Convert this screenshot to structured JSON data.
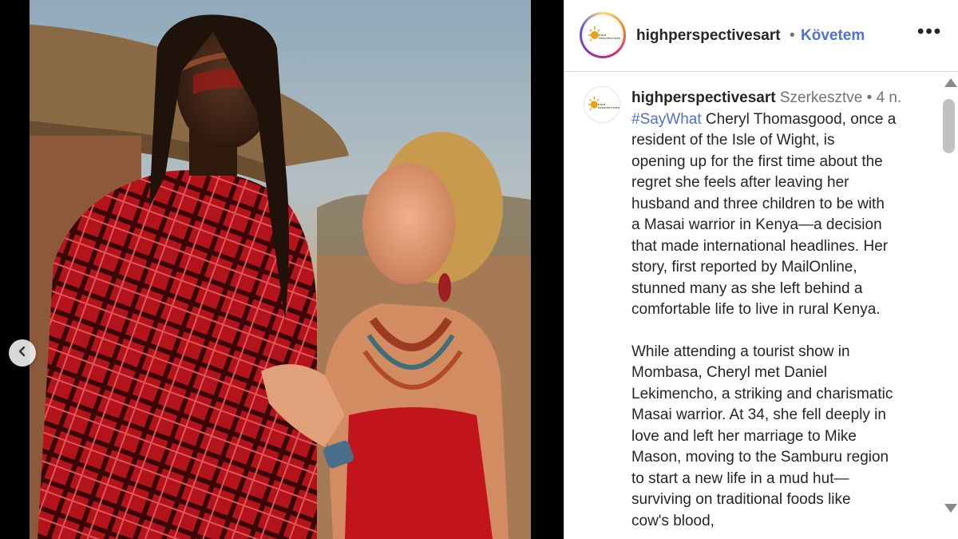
{
  "header": {
    "username": "highperspectivesart",
    "separator": "•",
    "follow_label": "Követem",
    "more_label": "•••"
  },
  "caption": {
    "username": "highperspectivesart",
    "edited_label": "Szerkesztve",
    "separator": "•",
    "time_ago": "4 n.",
    "hashtag": "#SayWhat",
    "line_1_rest": " Cheryl Thomasgood, once a",
    "lines_para1": [
      "resident of the Isle of Wight, is",
      "opening up for the first time about the",
      "regret she feels after leaving her",
      "husband and three children to be with",
      "a Masai warrior in Kenya—a decision",
      "that made international headlines. Her",
      "story, first reported by MailOnline,",
      "stunned many as she left behind a",
      "comfortable life to live in rural Kenya."
    ],
    "lines_para2": [
      "While attending a tourist show in",
      "Mombasa, Cheryl met Daniel",
      "Lekimencho, a striking and charismatic",
      "Masai warrior. At 34, she fell deeply in",
      "love and left her marriage to Mike",
      "Mason, moving to the Samburu region",
      "to start a new life in a mud hut—",
      "surviving on traditional foods like",
      "cow's blood,"
    ]
  },
  "logo": {
    "text": "HIGH PERSPECTIVES",
    "sun_color": "#e8a21a"
  },
  "colors": {
    "link": "#4f6fdc",
    "text": "#262626",
    "muted": "#737373"
  },
  "icons": {
    "prev": "chevron-left-icon",
    "more": "more-options-icon"
  }
}
